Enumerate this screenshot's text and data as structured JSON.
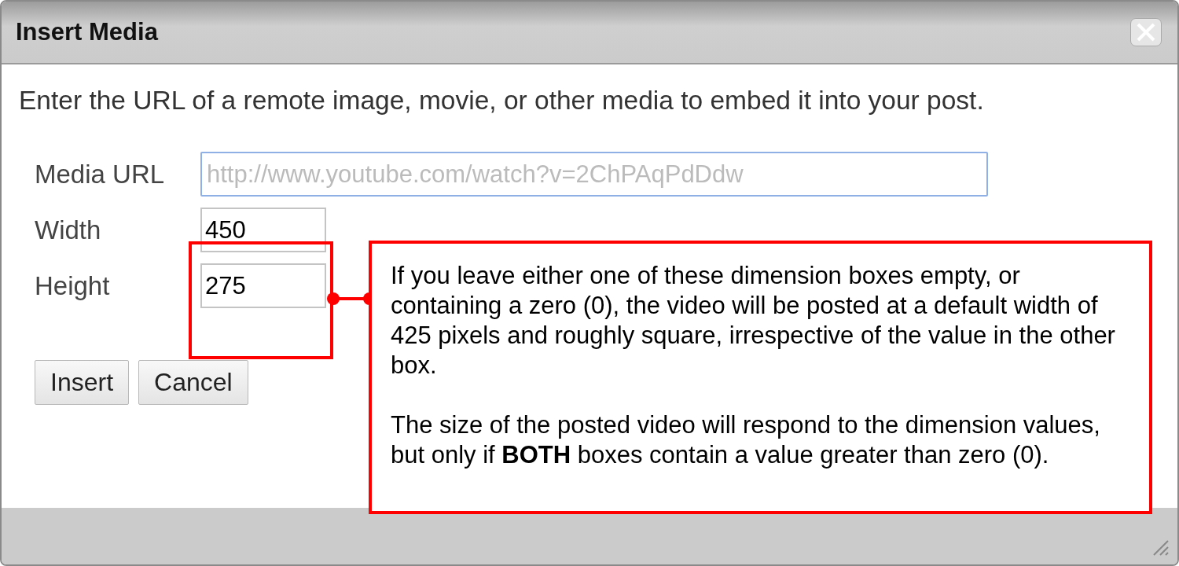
{
  "window": {
    "title": "Insert Media"
  },
  "description": "Enter the URL of a remote image, movie, or other media to embed it into your post.",
  "fields": [
    {
      "label": "Media URL",
      "placeholder": "http://www.youtube.com/watch?v=2ChPAqPdDdw",
      "kind": "url"
    },
    {
      "label": "Width",
      "value": "450",
      "kind": "size"
    },
    {
      "label": "Height",
      "value": "275",
      "kind": "size"
    }
  ],
  "buttons": [
    "Insert",
    "Cancel"
  ],
  "annotation": {
    "paragraphs": [
      "If you leave either one of these dimension boxes empty, or containing a zero (0), the video will be posted at a default width of 425 pixels and roughly square, irrespective of the value in the other box.",
      "The size of the posted video will respond to the dimension values, but only if **BOTH** boxes contain a value greater than zero (0)."
    ]
  }
}
